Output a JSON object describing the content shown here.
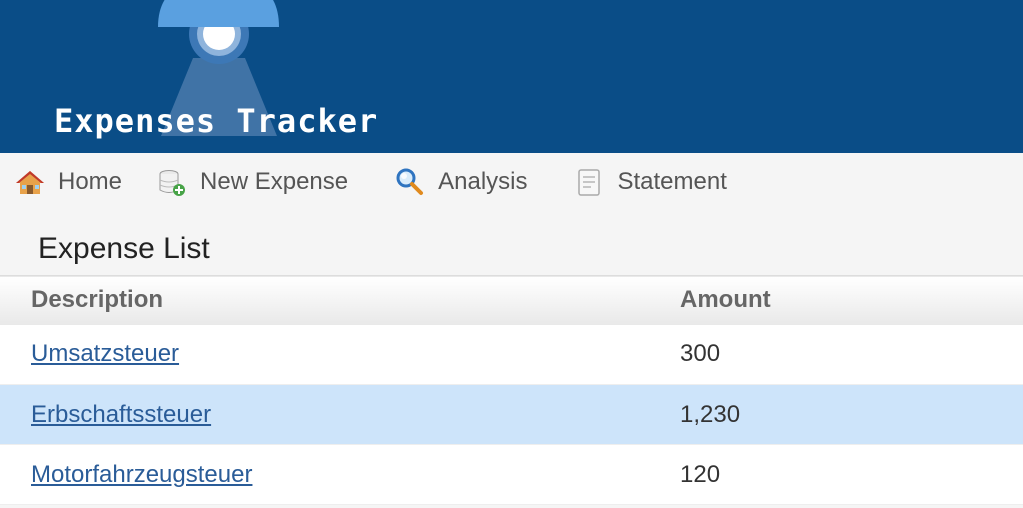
{
  "app": {
    "title": "Expenses Tracker",
    "colors": {
      "header_bg": "#0a4d87",
      "nav_bg": "#f5f5f5",
      "selected_row_bg": "#cde4fa",
      "link": "#2a5c98"
    }
  },
  "nav": {
    "items": [
      {
        "label": "Home",
        "icon": "home-icon"
      },
      {
        "label": "New Expense",
        "icon": "add-database-icon"
      },
      {
        "label": "Analysis",
        "icon": "magnifier-icon"
      },
      {
        "label": "Statement",
        "icon": "document-icon"
      }
    ]
  },
  "main": {
    "title": "Expense List",
    "table": {
      "columns": [
        "Description",
        "Amount"
      ],
      "rows": [
        {
          "description": "Umsatzsteuer",
          "amount": "300",
          "selected": false
        },
        {
          "description": "Erbschaftssteuer",
          "amount": "1,230",
          "selected": true
        },
        {
          "description": "Motorfahrzeugsteuer",
          "amount": "120",
          "selected": false
        }
      ]
    }
  }
}
